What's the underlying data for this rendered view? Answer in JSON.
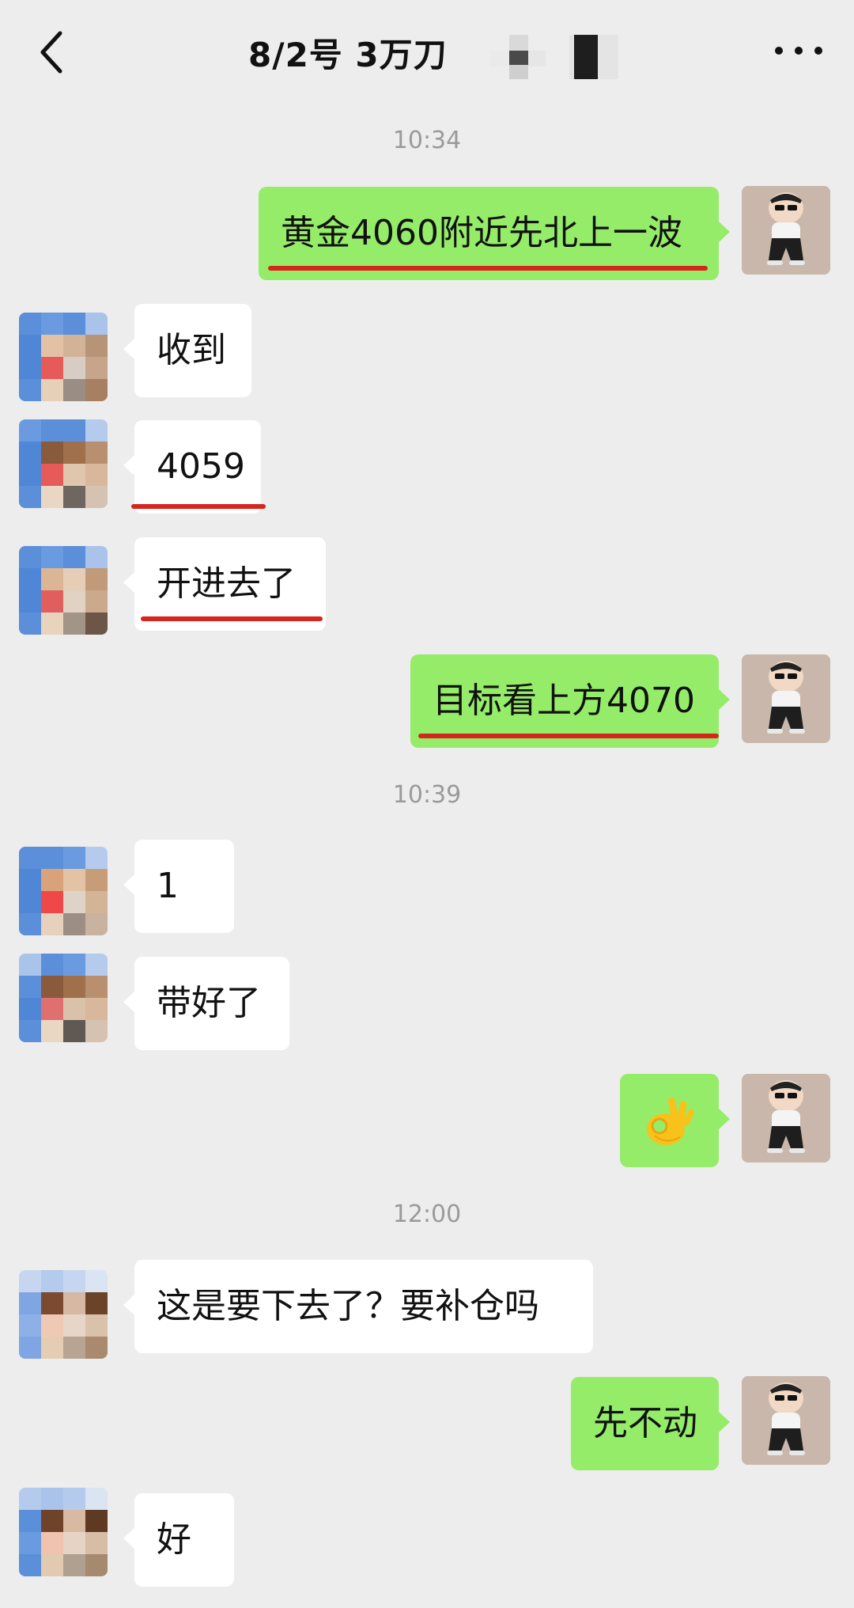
{
  "header": {
    "title": "8/2号  3万刀",
    "back_icon": "chevron-left-icon",
    "more_icon": "more-dots-icon"
  },
  "timestamps": [
    "10:34",
    "10:39",
    "12:00"
  ],
  "messages": [
    {
      "side": "me",
      "text": "黄金4060附近先北上一波",
      "underlined": true
    },
    {
      "side": "other",
      "text": "收到",
      "underlined": false
    },
    {
      "side": "other",
      "text": "4059",
      "underlined": true
    },
    {
      "side": "other",
      "text": "开进去了",
      "underlined": true
    },
    {
      "side": "me",
      "text": "目标看上方4070",
      "underlined": true
    },
    {
      "side": "other",
      "text": "1",
      "underlined": false
    },
    {
      "side": "other",
      "text": "带好了",
      "underlined": false
    },
    {
      "side": "me",
      "emoji": "ok-hand-emoji",
      "text": ""
    },
    {
      "side": "other",
      "text": "这是要下去了？要补仓吗",
      "underlined": false
    },
    {
      "side": "me",
      "text": "先不动",
      "underlined": false
    },
    {
      "side": "other",
      "text": "好",
      "underlined": false
    }
  ],
  "colors": {
    "background": "#ededed",
    "my_bubble": "#95ec69",
    "other_bubble": "#ffffff",
    "underline": "#d6251a",
    "timestamp": "#9a9a9a"
  }
}
